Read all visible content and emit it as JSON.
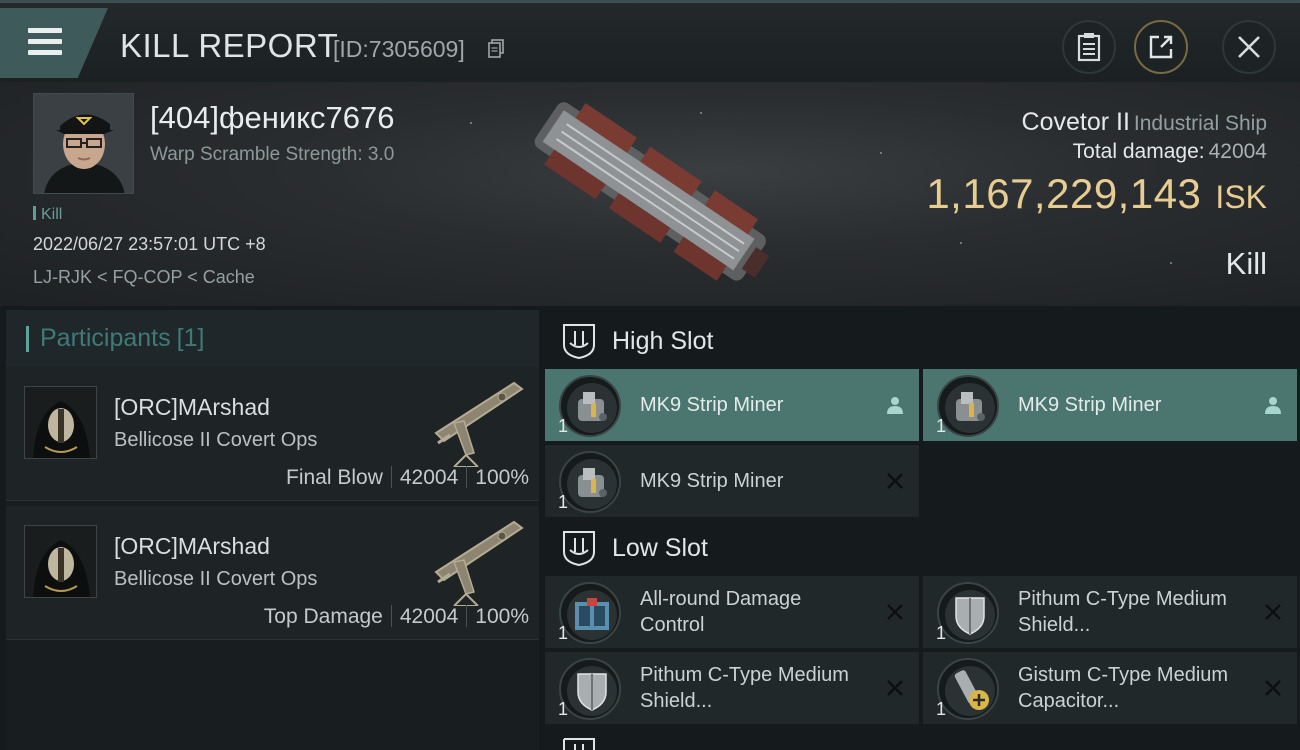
{
  "header": {
    "title": "KILL REPORT",
    "report_id": "[ID:7305609]"
  },
  "victim": {
    "name": "[404]феникс7676",
    "warp_scramble": "Warp Scramble Strength: 3.0",
    "tag": "Kill",
    "datetime": "2022/06/27 23:57:01 UTC +8",
    "location": "LJ-RJK < FQ-COP < Cache"
  },
  "ship": {
    "name": "Covetor II",
    "class": "Industrial Ship",
    "damage_label": "Total damage:",
    "damage_value": "42004",
    "isk_value": "1,167,229,143",
    "isk_unit": "ISK",
    "result": "Kill"
  },
  "participants": {
    "title": "Participants",
    "count": "[1]",
    "items": [
      {
        "name": "[ORC]MArshad",
        "ship": "Bellicose II Covert Ops",
        "role": "Final Blow",
        "damage": "42004",
        "percent": "100%"
      },
      {
        "name": "[ORC]MArshad",
        "ship": "Bellicose II Covert Ops",
        "role": "Top Damage",
        "damage": "42004",
        "percent": "100%"
      }
    ]
  },
  "high_slot": {
    "title": "High Slot",
    "modules": [
      {
        "name": "MK9 Strip Miner",
        "qty": "1",
        "icon": "strip-miner-icon",
        "action": "person-icon"
      },
      {
        "name": "MK9 Strip Miner",
        "qty": "1",
        "icon": "strip-miner-icon",
        "action": "person-icon"
      },
      {
        "name": "MK9 Strip Miner",
        "qty": "1",
        "icon": "strip-miner-icon",
        "action": "close-icon"
      }
    ]
  },
  "low_slot": {
    "title": "Low Slot",
    "modules": [
      {
        "name": "All-round Damage Control",
        "qty": "1",
        "icon": "damage-control-icon",
        "action": "close-icon"
      },
      {
        "name": "Pithum C-Type Medium Shield...",
        "qty": "1",
        "icon": "shield-icon",
        "action": "close-icon"
      },
      {
        "name": "Pithum C-Type Medium Shield...",
        "qty": "1",
        "icon": "shield-icon",
        "action": "close-icon"
      },
      {
        "name": "Gistum C-Type Medium Capacitor...",
        "qty": "1",
        "icon": "capacitor-icon",
        "action": "close-icon"
      }
    ]
  },
  "colors": {
    "accent_teal": "#4b7670",
    "isk_gold": "#e7cd92",
    "participants_teal": "#3f7a77"
  }
}
